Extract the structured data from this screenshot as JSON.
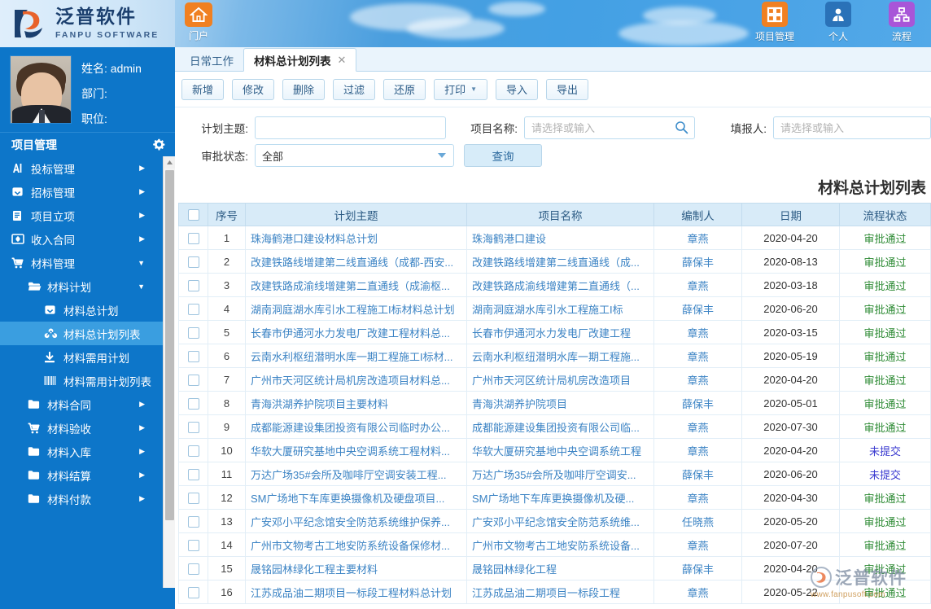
{
  "brand": {
    "name_cn": "泛普软件",
    "name_en": "FANPU SOFTWARE",
    "logo_icon": "fanpu-logo-icon"
  },
  "header": {
    "portal": {
      "label": "门户",
      "icon": "home-icon",
      "color": "#f08021"
    },
    "icons": [
      {
        "label": "项目管理",
        "icon": "grid-squares-icon",
        "color": "#f08021"
      },
      {
        "label": "个人",
        "icon": "user-person-icon",
        "color": "#2a72b8"
      },
      {
        "label": "流程",
        "icon": "workflow-node-icon",
        "color": "#a855d8"
      }
    ]
  },
  "sidebar": {
    "user": {
      "name_label": "姓名: admin",
      "dept_label": "部门:",
      "position_label": "职位:"
    },
    "section": {
      "title": "项目管理",
      "gear_icon": "gear-icon"
    },
    "items": [
      {
        "label": "投标管理",
        "icon": "bid-icon",
        "level": 1,
        "arrow": "right",
        "active": false
      },
      {
        "label": "招标管理",
        "icon": "inbox-icon",
        "level": 1,
        "arrow": "right",
        "active": false
      },
      {
        "label": "项目立项",
        "icon": "document-lines-icon",
        "level": 1,
        "arrow": "right",
        "active": false
      },
      {
        "label": "收入合同",
        "icon": "money-icon",
        "level": 1,
        "arrow": "right",
        "active": false
      },
      {
        "label": "材料管理",
        "icon": "cart-icon",
        "level": 1,
        "arrow": "down",
        "active": false
      },
      {
        "label": "材料计划",
        "icon": "folder-open-icon",
        "level": 2,
        "arrow": "down",
        "active": false
      },
      {
        "label": "材料总计划",
        "icon": "inbox-icon",
        "level": 3,
        "arrow": "none",
        "active": false
      },
      {
        "label": "材料总计划列表",
        "icon": "nodes-icon",
        "level": 3,
        "arrow": "none",
        "active": true
      },
      {
        "label": "材料需用计划",
        "icon": "download-icon",
        "level": 3,
        "arrow": "none",
        "active": false
      },
      {
        "label": "材料需用计划列表",
        "icon": "barcode-icon",
        "level": 3,
        "arrow": "none",
        "active": false
      },
      {
        "label": "材料合同",
        "icon": "folder-icon",
        "level": 2,
        "arrow": "right",
        "active": false
      },
      {
        "label": "材料验收",
        "icon": "cart-icon",
        "level": 2,
        "arrow": "right",
        "active": false
      },
      {
        "label": "材料入库",
        "icon": "folder-icon",
        "level": 2,
        "arrow": "right",
        "active": false
      },
      {
        "label": "材料结算",
        "icon": "folder-icon",
        "level": 2,
        "arrow": "right",
        "active": false
      },
      {
        "label": "材料付款",
        "icon": "folder-icon",
        "level": 2,
        "arrow": "right",
        "active": false
      }
    ]
  },
  "tabs": [
    {
      "label": "日常工作",
      "active": false,
      "closable": false
    },
    {
      "label": "材料总计划列表",
      "active": true,
      "closable": true,
      "close_icon": "close-icon"
    }
  ],
  "toolbar": [
    {
      "label": "新增",
      "dropdown": false
    },
    {
      "label": "修改",
      "dropdown": false
    },
    {
      "label": "删除",
      "dropdown": false
    },
    {
      "label": "过滤",
      "dropdown": false
    },
    {
      "label": "还原",
      "dropdown": false
    },
    {
      "label": "打印",
      "dropdown": true
    },
    {
      "label": "导入",
      "dropdown": false
    },
    {
      "label": "导出",
      "dropdown": false
    }
  ],
  "search": {
    "topic_label": "计划主题:",
    "topic_value": "",
    "topic_placeholder": "",
    "project_label": "项目名称:",
    "project_value": "",
    "project_placeholder": "请选择或输入",
    "project_search_icon": "search-icon",
    "reporter_label": "填报人:",
    "reporter_value": "",
    "reporter_placeholder": "请选择或输入",
    "status_label": "审批状态:",
    "status_value": "全部",
    "status_options": [
      "全部"
    ],
    "query_button": "查询"
  },
  "list_title": "材料总计划列表",
  "table": {
    "columns": [
      "",
      "序号",
      "计划主题",
      "项目名称",
      "编制人",
      "日期",
      "流程状态"
    ],
    "rows": [
      {
        "idx": "1",
        "topic": "珠海鹤港口建设材料总计划",
        "project": "珠海鹤港口建设",
        "user": "章燕",
        "date": "2020-04-20",
        "status": "审批通过"
      },
      {
        "idx": "2",
        "topic": "改建铁路线增建第二线直通线（成都-西安...",
        "project": "改建铁路线增建第二线直通线（成...",
        "user": "薛保丰",
        "date": "2020-08-13",
        "status": "审批通过"
      },
      {
        "idx": "3",
        "topic": "改建铁路成渝线增建第二直通线（成渝枢...",
        "project": "改建铁路成渝线增建第二直通线（...",
        "user": "章燕",
        "date": "2020-03-18",
        "status": "审批通过"
      },
      {
        "idx": "4",
        "topic": "湖南洞庭湖水库引水工程施工I标材料总计划",
        "project": "湖南洞庭湖水库引水工程施工I标",
        "user": "薛保丰",
        "date": "2020-06-20",
        "status": "审批通过"
      },
      {
        "idx": "5",
        "topic": "长春市伊通河水力发电厂改建工程材料总...",
        "project": "长春市伊通河水力发电厂改建工程",
        "user": "章燕",
        "date": "2020-03-15",
        "status": "审批通过"
      },
      {
        "idx": "6",
        "topic": "云南水利枢纽潜明水库一期工程施工I标材...",
        "project": "云南水利枢纽潜明水库一期工程施...",
        "user": "章燕",
        "date": "2020-05-19",
        "status": "审批通过"
      },
      {
        "idx": "7",
        "topic": "广州市天河区统计局机房改造项目材料总...",
        "project": "广州市天河区统计局机房改造项目",
        "user": "章燕",
        "date": "2020-04-20",
        "status": "审批通过"
      },
      {
        "idx": "8",
        "topic": "青海洪湖养护院项目主要材料",
        "project": "青海洪湖养护院项目",
        "user": "薛保丰",
        "date": "2020-05-01",
        "status": "审批通过"
      },
      {
        "idx": "9",
        "topic": "成都能源建设集团投资有限公司临时办公...",
        "project": "成都能源建设集团投资有限公司临...",
        "user": "章燕",
        "date": "2020-07-30",
        "status": "审批通过"
      },
      {
        "idx": "10",
        "topic": "华软大厦研究基地中央空调系统工程材料...",
        "project": "华软大厦研究基地中央空调系统工程",
        "user": "章燕",
        "date": "2020-04-20",
        "status": "未提交"
      },
      {
        "idx": "11",
        "topic": "万达广场35#会所及咖啡厅空调安装工程...",
        "project": "万达广场35#会所及咖啡厅空调安...",
        "user": "薛保丰",
        "date": "2020-06-20",
        "status": "未提交"
      },
      {
        "idx": "12",
        "topic": "SM广场地下车库更换摄像机及硬盘项目...",
        "project": "SM广场地下车库更换摄像机及硬...",
        "user": "章燕",
        "date": "2020-04-30",
        "status": "审批通过"
      },
      {
        "idx": "13",
        "topic": "广安邓小平纪念馆安全防范系统维护保养...",
        "project": "广安邓小平纪念馆安全防范系统维...",
        "user": "任晓燕",
        "date": "2020-05-20",
        "status": "审批通过"
      },
      {
        "idx": "14",
        "topic": "广州市文物考古工地安防系统设备保修材...",
        "project": "广州市文物考古工地安防系统设备...",
        "user": "章燕",
        "date": "2020-07-20",
        "status": "审批通过"
      },
      {
        "idx": "15",
        "topic": "晟铭园林绿化工程主要材料",
        "project": "晟铭园林绿化工程",
        "user": "薛保丰",
        "date": "2020-04-20",
        "status": "审批通过"
      },
      {
        "idx": "16",
        "topic": "江苏成品油二期项目一标段工程材料总计划",
        "project": "江苏成品油二期项目一标段工程",
        "user": "章燕",
        "date": "2020-05-22",
        "status": "审批通过"
      }
    ]
  },
  "watermark": {
    "text_cn": "泛普软件",
    "url": "www.fanpusoft.com"
  },
  "colors": {
    "sidebar_bg": "#0d76c9",
    "sidebar_active": "#3a9ee0",
    "header_blue": "#4a9ede",
    "accent_orange": "#f08021",
    "link_blue": "#3b83c4",
    "status_pass": "#2e8b35",
    "status_pending": "#3b3bd0"
  }
}
